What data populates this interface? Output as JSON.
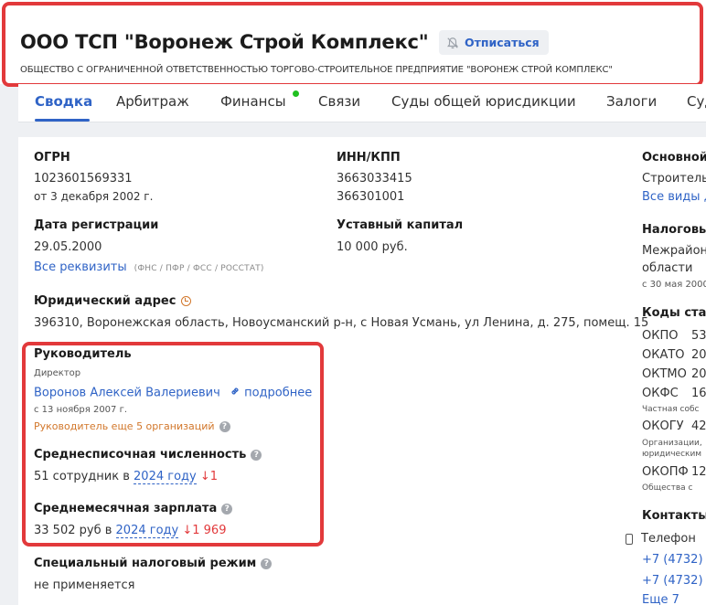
{
  "header": {
    "title": "ООО ТСП \"Воронеж Строй Комплекс\"",
    "unsubscribe_label": "Отписаться",
    "full_name": "ОБЩЕСТВО С ОГРАНИЧЕННОЙ ОТВЕТСТВЕННОСТЬЮ ТОРГОВО-СТРОИТЕЛЬНОЕ ПРЕДПРИЯТИЕ \"ВОРОНЕЖ СТРОЙ КОМПЛЕКС\""
  },
  "tabs": [
    {
      "label": "Сводка"
    },
    {
      "label": "Арбитраж"
    },
    {
      "label": "Финансы"
    },
    {
      "label": "Связи"
    },
    {
      "label": "Суды общей юрисдикции"
    },
    {
      "label": "Залоги"
    },
    {
      "label": "Суд"
    }
  ],
  "ogrn": {
    "label": "ОГРН",
    "value": "1023601569331",
    "date": "от 3 декабря 2002 г."
  },
  "inn": {
    "label": "ИНН/КПП",
    "inn": "3663033415",
    "kpp": "366301001"
  },
  "reg": {
    "label": "Дата регистрации",
    "value": "29.05.2000"
  },
  "capital": {
    "label": "Уставный капитал",
    "value": "10 000 руб."
  },
  "requisites": {
    "link": "Все реквизиты",
    "note": "(ФНС / ПФР / ФСС / РОССТАТ)"
  },
  "address": {
    "label": "Юридический адрес",
    "value": "396310, Воронежская область, Новоусманский р-н, с Новая Усмань, ул Ленина, д. 275, помещ. 15"
  },
  "head": {
    "label": "Руководитель",
    "role": "Директор",
    "name": "Воронов Алексей Валериевич",
    "more": "подробнее",
    "since": "с 13 ноября 2007 г.",
    "other_orgs": "Руководитель еще 5 организаций"
  },
  "staff": {
    "label": "Среднесписочная численность",
    "prefix": "51 сотрудник в",
    "year": "2024 году",
    "delta": "↓1"
  },
  "salary": {
    "label": "Среднемесячная зарплата",
    "prefix": "33 502 руб в",
    "year": "2024 году",
    "delta": "↓1 969"
  },
  "tax_regime": {
    "label": "Специальный налоговый режим",
    "value": "не применяется"
  },
  "right": {
    "activity_label": "Основной",
    "activity_value": "Строитель",
    "activity_link": "Все виды д",
    "tax_label": "Налоговы",
    "tax_value1": "Межрайон",
    "tax_value2": "области",
    "tax_date": "с 30 мая 2000",
    "codes_label": "Коды стат",
    "codes": [
      {
        "name": "ОКПО",
        "value": "53"
      },
      {
        "name": "ОКАТО",
        "value": "20"
      },
      {
        "name": "ОКТМО",
        "value": "20"
      },
      {
        "name": "ОКФС",
        "value": "16"
      }
    ],
    "okfs_note": "Частная собс",
    "okogu_name": "ОКОГУ",
    "okogu_value": "42",
    "okogu_note1": "Организации,",
    "okogu_note2": "юридическим",
    "okopf_name": "ОКОПФ",
    "okopf_value": "12",
    "okopf_note": "Общества с",
    "contacts_label": "Контакты",
    "phone_label": "Телефон",
    "phone1": "+7 (4732) 4",
    "phone2": "+7 (4732) 4",
    "more_phones": "Еще 7"
  },
  "colors": {
    "accent": "#2f63c6",
    "highlight": "#e2393b",
    "warning": "#d2772b",
    "dot": "#20c020"
  }
}
